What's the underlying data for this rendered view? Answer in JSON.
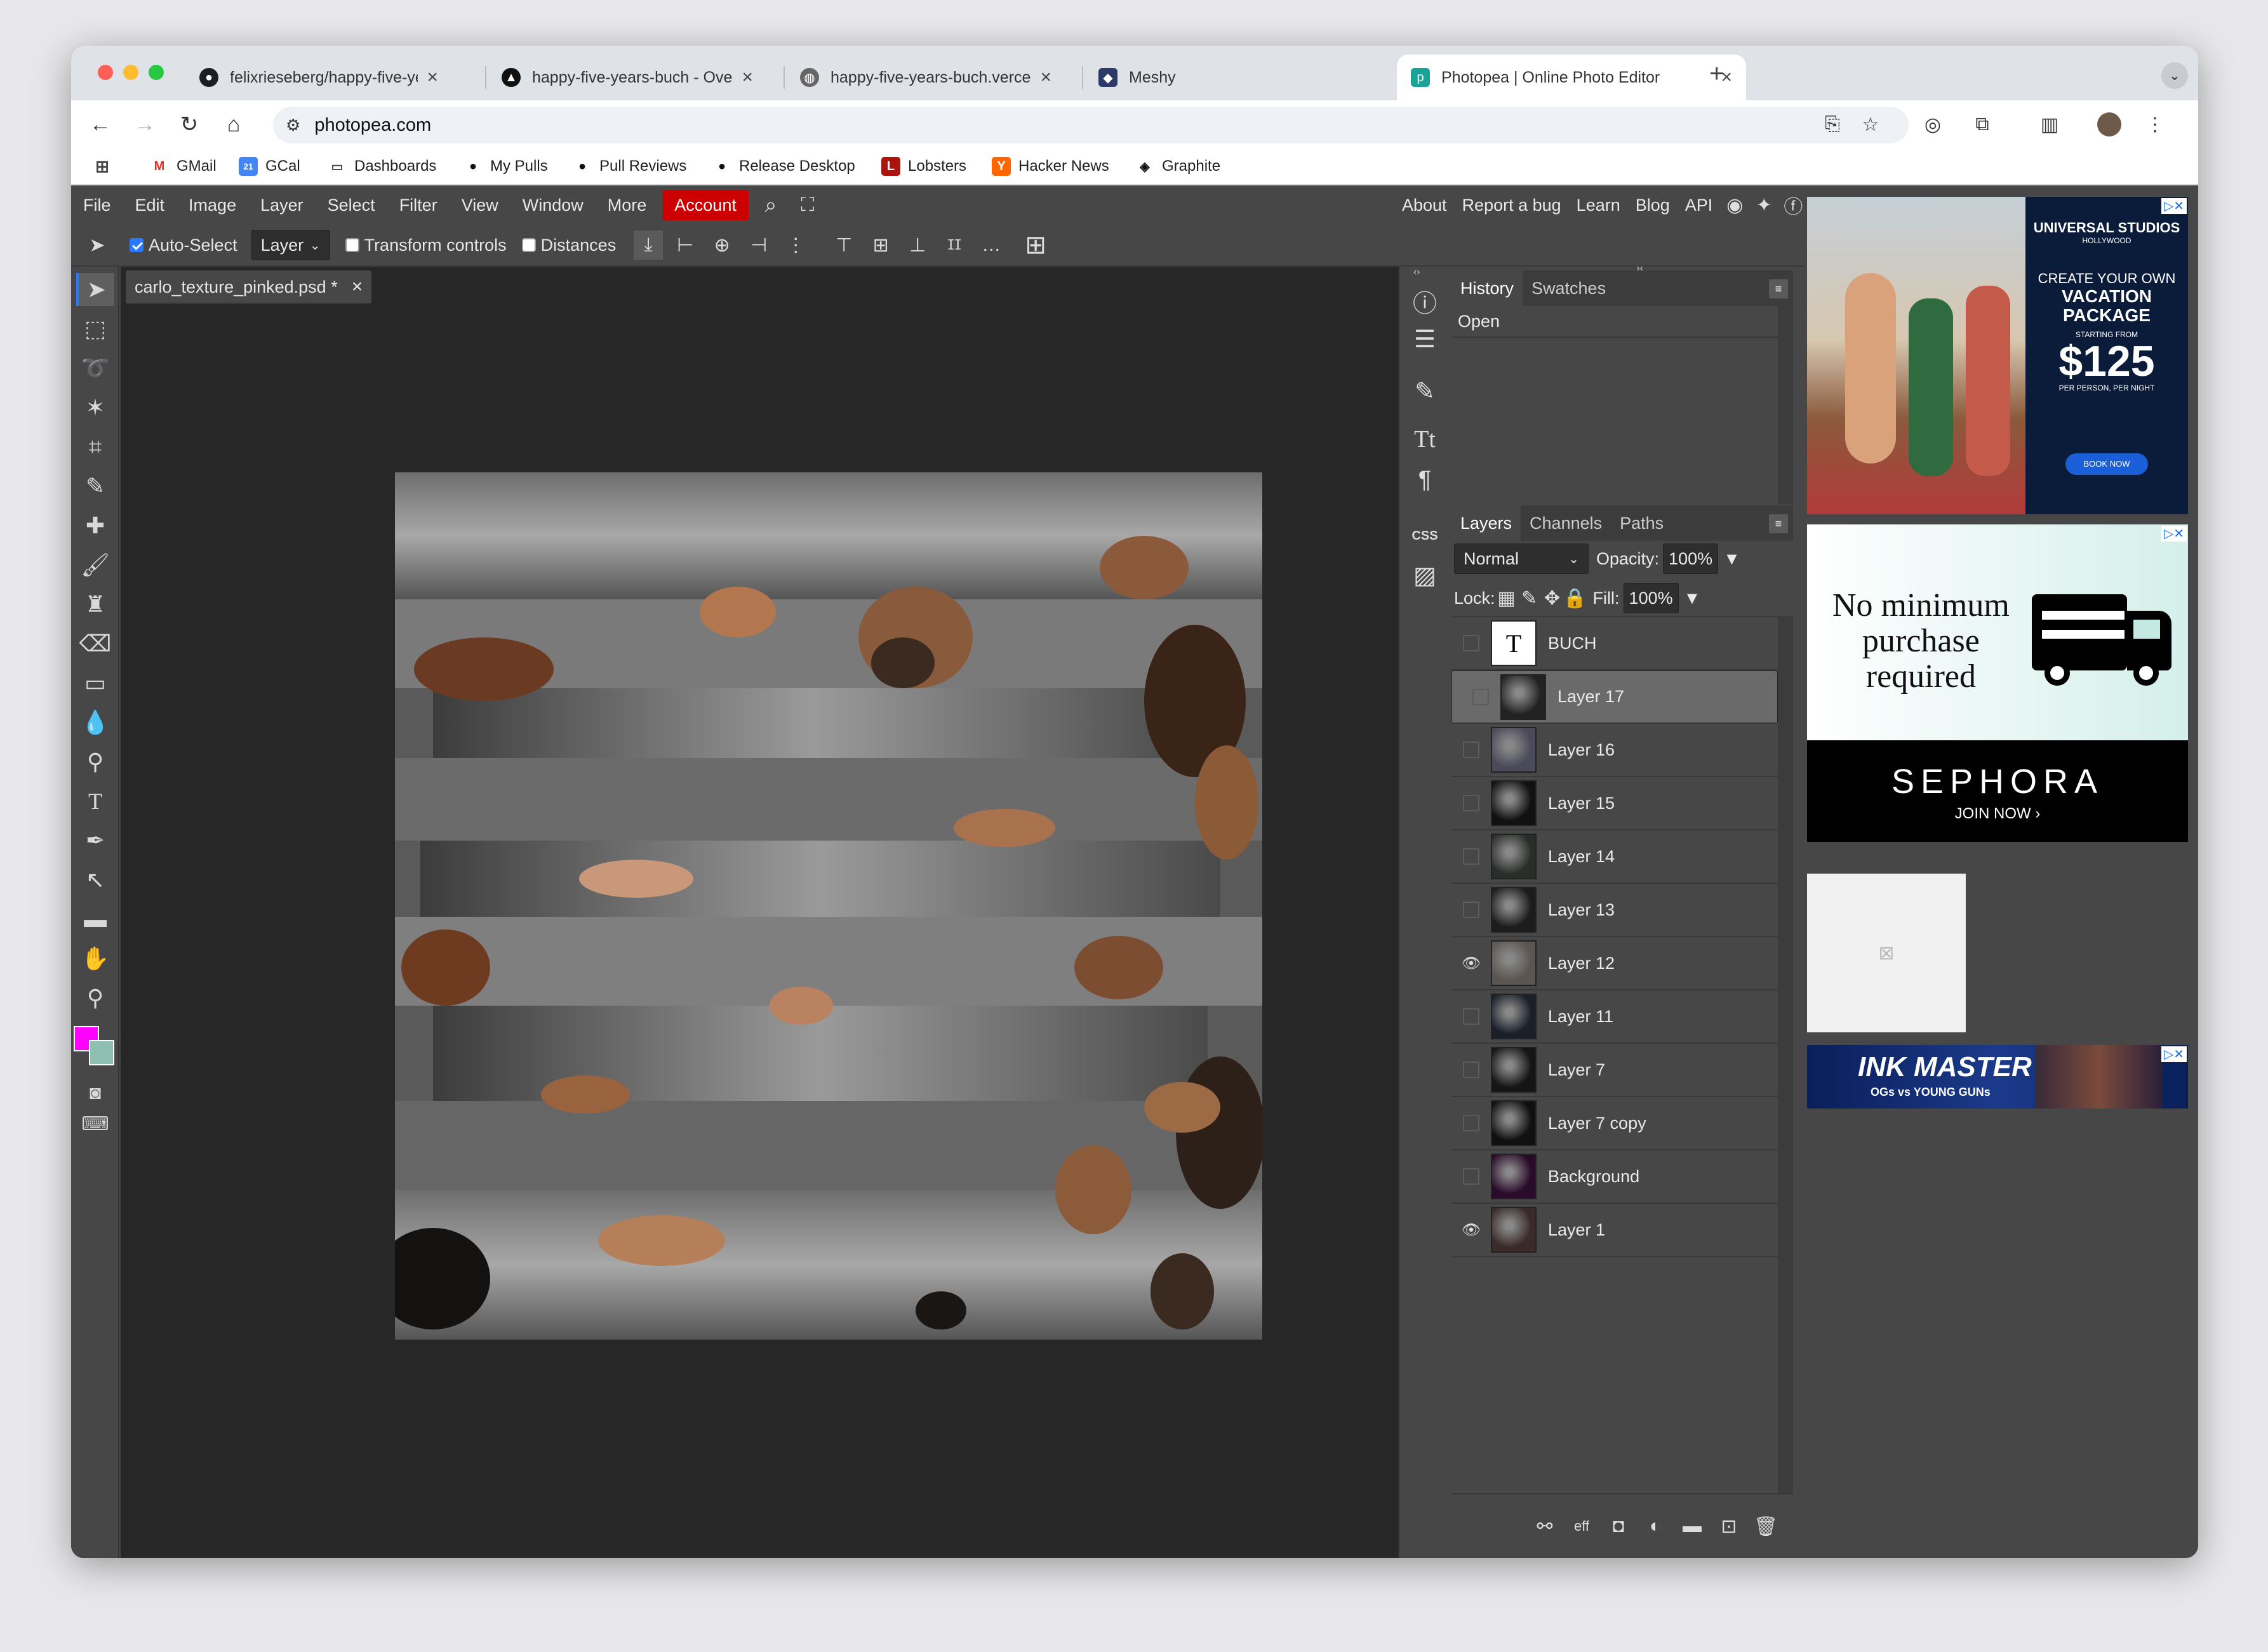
{
  "tabs": [
    {
      "title": "felixrieseberg/happy-five-years-buch",
      "icon": "github-icon"
    },
    {
      "title": "happy-five-years-buch - Overview",
      "icon": "vercel-icon"
    },
    {
      "title": "happy-five-years-buch.vercel.app",
      "icon": "globe-icon"
    },
    {
      "title": "Meshy",
      "icon": "meshy-icon"
    },
    {
      "title": "Photopea | Online Photo Editor",
      "icon": "photopea-icon",
      "active": true
    }
  ],
  "url": "photopea.com",
  "bookmarks": [
    "GMail",
    "GCal",
    "Dashboards",
    "My Pulls",
    "Pull Reviews",
    "Release Desktop",
    "Lobsters",
    "Hacker News",
    "Graphite"
  ],
  "menu": [
    "File",
    "Edit",
    "Image",
    "Layer",
    "Select",
    "Filter",
    "View",
    "Window",
    "More"
  ],
  "account_label": "Account",
  "right_links": [
    "About",
    "Report a bug",
    "Learn",
    "Blog",
    "API"
  ],
  "options": {
    "auto_select_label": "Auto-Select",
    "auto_select_checked": true,
    "select_target": "Layer",
    "transform_label": "Transform controls",
    "distances_label": "Distances"
  },
  "document": {
    "tab_title": "carlo_texture_pinked.psd *"
  },
  "history": {
    "tabs": [
      "History",
      "Swatches"
    ],
    "items": [
      "Open"
    ]
  },
  "layers_panel": {
    "tabs": [
      "Layers",
      "Channels",
      "Paths"
    ],
    "blend_mode": "Normal",
    "opacity_label": "Opacity:",
    "opacity": "100%",
    "lock_label": "Lock:",
    "fill_label": "Fill:",
    "fill": "100%",
    "layers": [
      {
        "name": "BUCH",
        "visible": false,
        "type": "text"
      },
      {
        "name": "Layer 17",
        "visible": false,
        "selected": true
      },
      {
        "name": "Layer 16",
        "visible": false
      },
      {
        "name": "Layer 15",
        "visible": false
      },
      {
        "name": "Layer 14",
        "visible": false
      },
      {
        "name": "Layer 13",
        "visible": false
      },
      {
        "name": "Layer 12",
        "visible": true
      },
      {
        "name": "Layer 11",
        "visible": false
      },
      {
        "name": "Layer 7",
        "visible": false
      },
      {
        "name": "Layer 7 copy",
        "visible": false
      },
      {
        "name": "Background",
        "visible": false
      },
      {
        "name": "Layer 1",
        "visible": true
      }
    ]
  },
  "colors": {
    "foreground": "#ff00ff",
    "background": "#8fbfb0",
    "account": "#cc0000"
  },
  "ads": {
    "universal": {
      "brand": "UNIVERSAL STUDIOS",
      "sub": "HOLLYWOOD",
      "headline": "CREATE YOUR OWN",
      "headline2": "VACATION PACKAGE",
      "from": "STARTING FROM",
      "price": "125",
      "per": "PER PERSON, PER NIGHT",
      "cta": "BOOK NOW"
    },
    "sephora": {
      "line1": "No minimum",
      "line2": "purchase",
      "line3": "required",
      "brand": "SEPHORA",
      "cta": "JOIN NOW ›"
    },
    "inkmaster": {
      "title": "INK MASTER",
      "sub": "OGs vs YOUNG GUNs"
    }
  }
}
